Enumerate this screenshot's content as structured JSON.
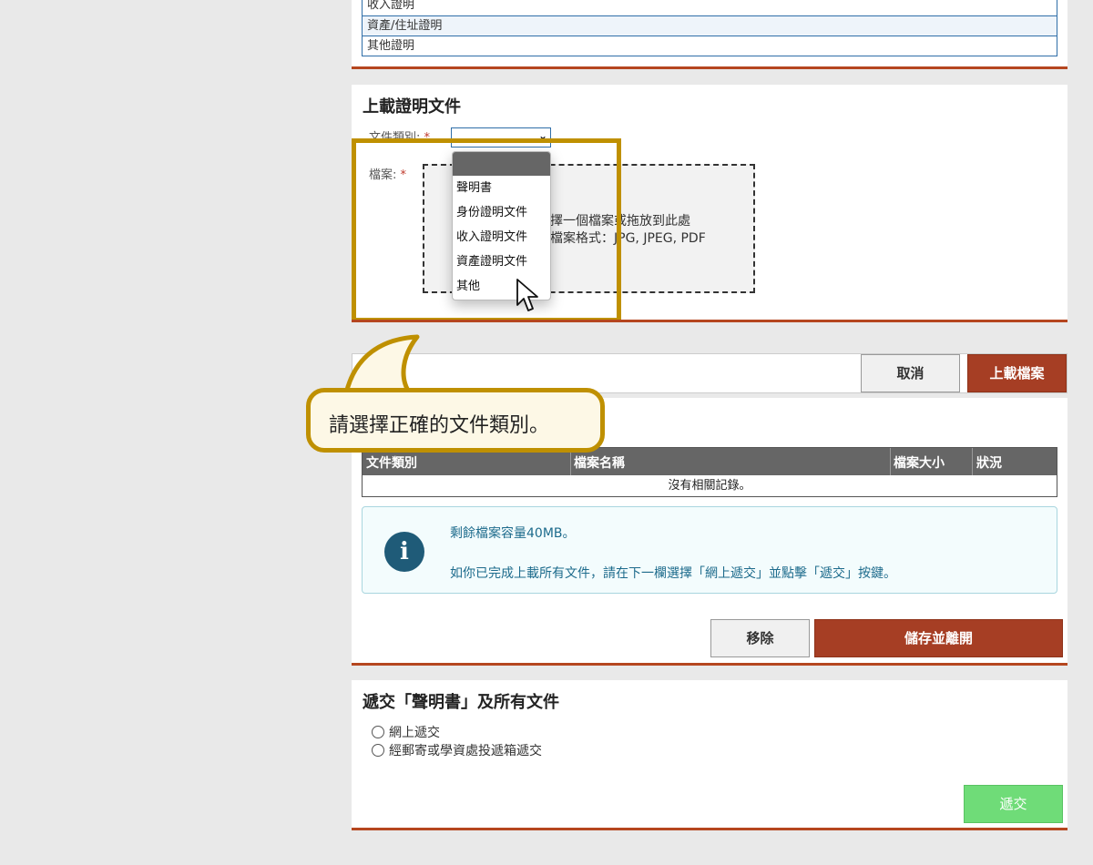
{
  "doc_list": [
    "收入證明",
    "資產/住址證明",
    "其他證明"
  ],
  "upload": {
    "title": "上載證明文件",
    "doc_type_label": "文件類別:",
    "file_label": "檔案:",
    "required_mark": "*",
    "dropzone_line1": "擇一個檔案或拖放到此處",
    "dropzone_line2": "檔案格式：JPG, JPEG, PDF",
    "select_value": "",
    "dropdown_options": [
      "聲明書",
      "身份證明文件",
      "收入證明文件",
      "資產證明文件",
      "其他"
    ]
  },
  "toolbar": {
    "cancel_label": "取消",
    "upload_label": "上載檔案"
  },
  "callout": {
    "text": "請選擇正確的文件類別。"
  },
  "files_table": {
    "columns": [
      "文件類別",
      "檔案名稱",
      "檔案大小",
      "狀況"
    ],
    "empty_text": "沒有相關記錄。"
  },
  "info": {
    "icon": "info-icon",
    "line1": "剩餘檔案容量40MB。",
    "line2": "如你已完成上載所有文件，請在下一欄選擇「網上遞交」並點擊「遞交」按鍵。"
  },
  "list_actions": {
    "remove_label": "移除",
    "save_exit_label": "儲存並離開"
  },
  "submit": {
    "title": "遞交「聲明書」及所有文件",
    "options": [
      "網上遞交",
      "經郵寄或學資處投遞箱遞交"
    ],
    "submit_label": "遞交"
  },
  "colors": {
    "accent": "#b5461f",
    "button_red": "#a63e24",
    "button_green": "#6fdc78",
    "highlight": "#bf9000",
    "info": "#1f5b78"
  }
}
